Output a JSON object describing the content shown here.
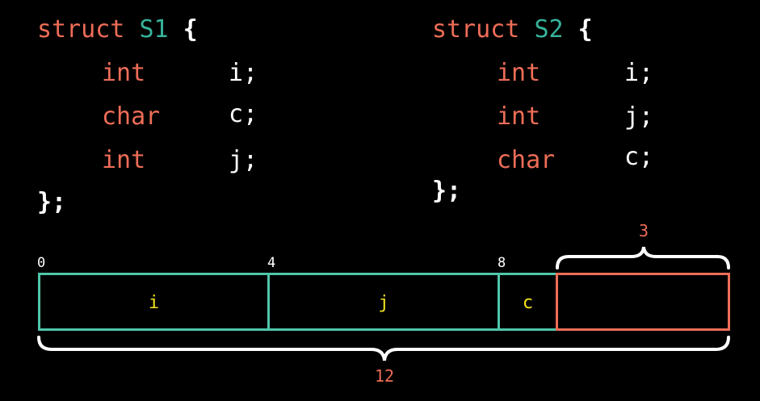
{
  "s1": {
    "keyword": "struct",
    "name": "S1",
    "open": "{",
    "close": "};",
    "fields": [
      {
        "type": "int",
        "name": "i;"
      },
      {
        "type": "char",
        "name": "c;"
      },
      {
        "type": "int",
        "name": "j;"
      }
    ]
  },
  "s2": {
    "keyword": "struct",
    "name": "S2",
    "open": "{",
    "close": "};",
    "fields": [
      {
        "type": "int",
        "name": "i;"
      },
      {
        "type": "int",
        "name": "j;"
      },
      {
        "type": "char",
        "name": "c;"
      }
    ]
  },
  "layout": {
    "offsets": [
      "0",
      "4",
      "8"
    ],
    "cells": [
      "i",
      "j",
      "c"
    ],
    "padding_size": "3",
    "total_size": "12"
  },
  "colors": {
    "keyword": "#ee6d57",
    "type_name": "#36b39b",
    "cell_border": "#4fc6a9",
    "padding_border": "#ee6d57",
    "cell_label": "#f4e51c"
  }
}
